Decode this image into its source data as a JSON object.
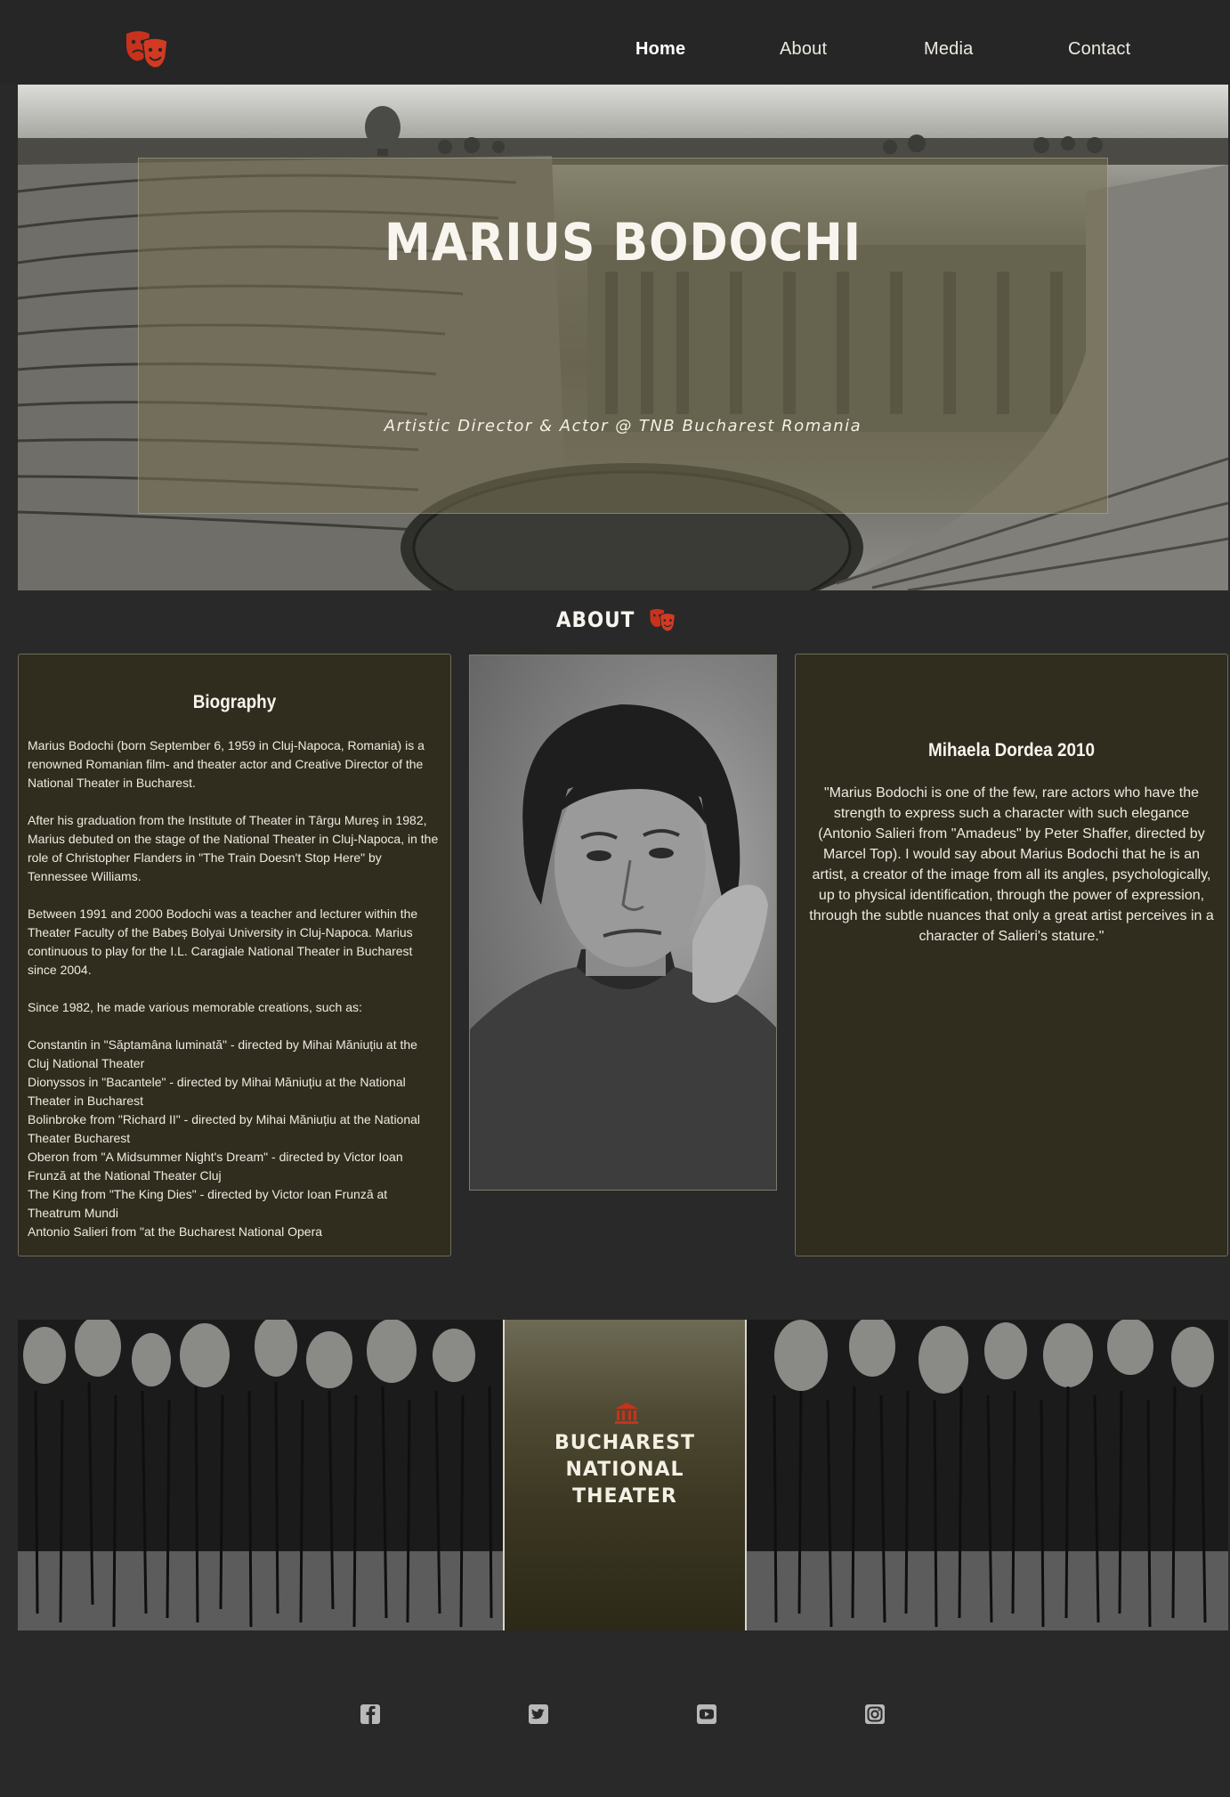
{
  "nav": {
    "logo": "theater-masks-icon",
    "items": [
      {
        "label": "Home",
        "active": true
      },
      {
        "label": "About",
        "active": false
      },
      {
        "label": "Media",
        "active": false
      },
      {
        "label": "Contact",
        "active": false
      }
    ]
  },
  "hero": {
    "title": "MARIUS BODOCHI",
    "subtitle": "Artistic Director & Actor @ TNB Bucharest Romania"
  },
  "about": {
    "heading": "ABOUT",
    "heading_icon": "theater-masks-icon"
  },
  "biography": {
    "title": "Biography",
    "paragraphs": [
      "Marius Bodochi (born September 6, 1959 in Cluj-Napoca, Romania) is a renowned Romanian film- and theater actor and Creative Director of the National Theater in Bucharest.",
      "After his graduation from the Institute of Theater in Târgu Mureș in 1982, Marius debuted on the stage of the National Theater in Cluj-Napoca, in the role of Christopher Flanders in \"The Train Doesn't Stop Here\" by Tennessee Williams.",
      "Between 1991 and 2000 Bodochi was a teacher and lecturer within the Theater Faculty of the Babeș Bolyai University in Cluj-Napoca. Marius continuous to play for the I.L. Caragiale National Theater in Bucharest since 2004.",
      "Since 1982, he made various memorable creations, such as:"
    ],
    "roles": [
      "Constantin in \"Săptamâna luminată\" - directed by Mihai Măniuțiu at the Cluj National Theater",
      "Dionyssos in \"Bacantele\" - directed by Mihai Măniuțiu at the National Theater in Bucharest",
      "Bolinbroke from \"Richard II\" - directed by Mihai Măniuțiu at the National Theater Bucharest",
      "Oberon from \"A Midsummer Night's Dream\" - directed by Victor Ioan Frunză at the National Theater Cluj",
      "The King from \"The King Dies\" - directed by Victor Ioan Frunză at Theatrum Mundi",
      "Antonio Salieri from \"at the Bucharest National Opera"
    ]
  },
  "quote": {
    "title": "Mihaela Dordea 2010",
    "text": "\"Marius Bodochi is one of the few, rare actors who have the strength to express such a character with such elegance (Antonio Salieri from \"Amadeus\" by Peter Shaffer, directed by Marcel Top). I would say about Marius Bodochi that he is an artist, a creator of the image from all its angles, psychologically, up to physical identification, through the power of expression, through the subtle nuances that only a great artist perceives in a character of Salieri's stature.\""
  },
  "banner": {
    "icon": "landmark-icon",
    "title_line1": "BUCHAREST NATIONAL",
    "title_line2": "THEATER"
  },
  "social": [
    "facebook-icon",
    "twitter-icon",
    "youtube-icon",
    "instagram-icon"
  ],
  "colors": {
    "background": "#292929",
    "card": "#302d1f",
    "accent_red": "#c8321c"
  }
}
